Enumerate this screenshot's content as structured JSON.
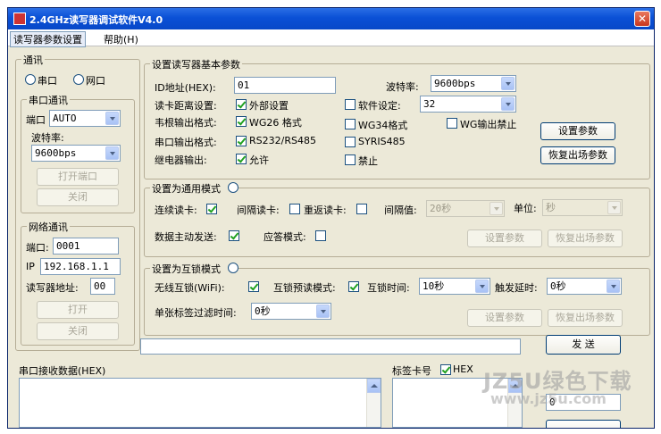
{
  "window": {
    "title": "2.4GHz读写器调试软件V4.0",
    "close": "✕"
  },
  "menu": [
    "读写器参数设置",
    "帮助(H)"
  ],
  "comm": {
    "title": "通讯",
    "radio_serial": "串口",
    "radio_net": "网口",
    "serial": {
      "title": "串口通讯",
      "port_label": "端口",
      "port_value": "AUTO",
      "baud_label": "波特率:",
      "baud_value": "9600bps",
      "open_btn": "打开端口",
      "close_btn": "关闭"
    },
    "network": {
      "title": "网络通讯",
      "port_label": "端口:",
      "port_value": "0001",
      "ip_label": "IP",
      "ip_value": "192.168.1.1",
      "addr_label": "读写器地址:",
      "addr_value": "00",
      "open_btn": "打开",
      "close_btn": "关闭"
    }
  },
  "basic": {
    "title": "设置读写器基本参数",
    "id_label": "ID地址(HEX):",
    "id_value": "01",
    "baud_label": "波特率:",
    "baud_value": "9600bps",
    "distance_label": "读卡距离设置:",
    "distance_opt": "外部设置",
    "software_label": "软件设定:",
    "software_value": "32",
    "wiegand_label": "韦根输出格式:",
    "wg26": "WG26 格式",
    "wg34": "WG34格式",
    "wg_disable": "WG输出禁止",
    "serial_out_label": "串口输出格式:",
    "rs": "RS232/RS485",
    "syris": "SYRIS485",
    "relay_label": "继电器输出:",
    "relay_allow": "允许",
    "relay_forbid": "禁止",
    "set_btn": "设置参数",
    "restore_btn": "恢复出场参数"
  },
  "generic": {
    "title": "设置为通用模式",
    "continuous_label": "连续读卡:",
    "interval_label": "间隔读卡:",
    "repeat_label": "重返读卡:",
    "interval_value_label": "间隔值:",
    "interval_value": "20秒",
    "unit_label": "单位:",
    "unit_value": "秒",
    "active_send_label": "数据主动发送:",
    "answer_label": "应答模式:",
    "set_btn": "设置参数",
    "restore_btn": "恢复出场参数"
  },
  "interlock": {
    "title": "设置为互锁模式",
    "wireless_label": "无线互锁(WiFi):",
    "preread_label": "互锁预读模式:",
    "time_label": "互锁时间:",
    "time_value": "10秒",
    "delay_label": "触发延时:",
    "delay_value": "0秒",
    "filter_label": "单张标签过滤时间:",
    "filter_value": "0秒",
    "set_btn": "设置参数",
    "restore_btn": "恢复出场参数"
  },
  "send": {
    "input_value": "",
    "button": "发 送"
  },
  "receive": {
    "label": "串口接收数据(HEX)"
  },
  "tags": {
    "label": "标签卡号",
    "hex_label": "HEX",
    "count_value": "0"
  },
  "watermark": {
    "line1": "JZ5U绿色下载",
    "line2": "www.jz5u.com"
  }
}
